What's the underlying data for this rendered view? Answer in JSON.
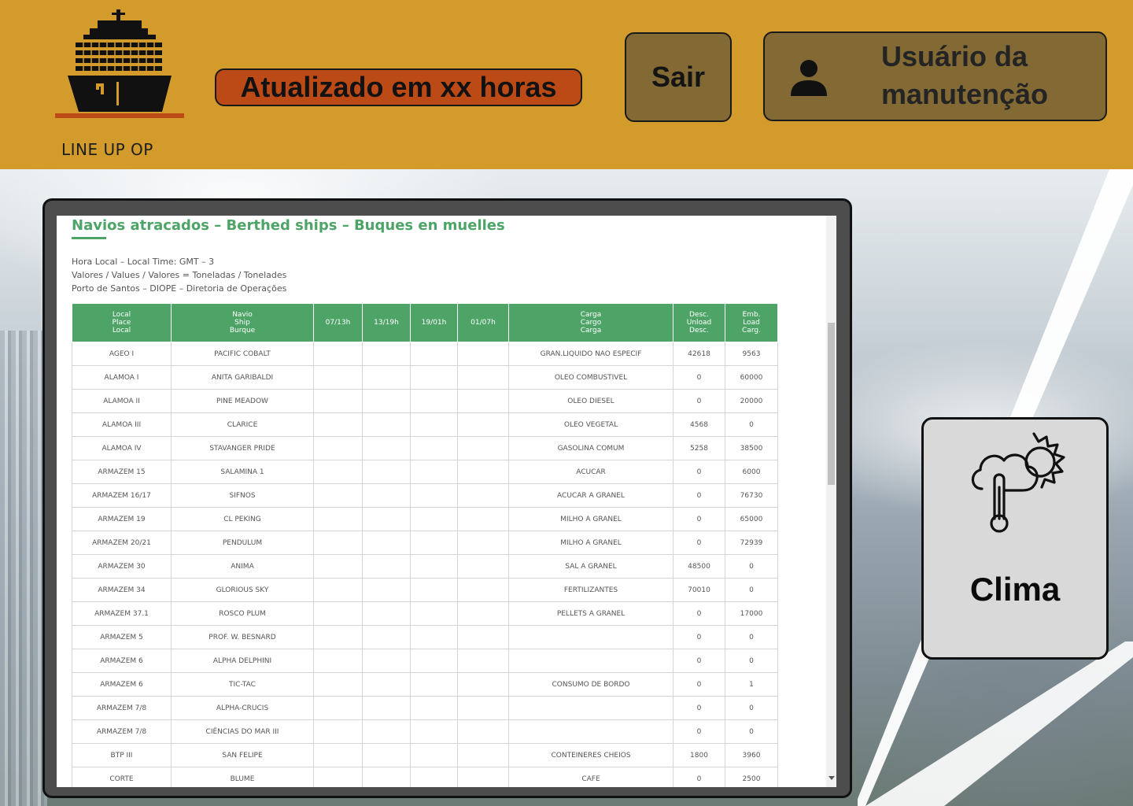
{
  "brand": {
    "name": "LINE UP OP"
  },
  "header": {
    "updated_label": "Atualizado em xx horas",
    "logout_label": "Sair",
    "user_label": "Usuário da manutenção"
  },
  "report": {
    "title": "Navios atracados – Berthed ships – Buques en muelles",
    "info": [
      "Hora Local – Local Time: GMT – 3",
      "Valores / Values / Valores = Toneladas / Tonelades",
      "Porto de Santos – DIOPE – Diretoria de Operações"
    ],
    "columns": [
      "Local\nPlace\nLocal",
      "Navio\nShip\nBurque",
      "07/13h",
      "13/19h",
      "19/01h",
      "01/07h",
      "Carga\nCargo\nCarga",
      "Desc.\nUnload\nDesc.",
      "Emb.\nLoad\nCarg."
    ],
    "rows": [
      [
        "AGEO I",
        "PACIFIC COBALT",
        "",
        "",
        "",
        "",
        "GRAN.LIQUIDO NAO ESPECIF",
        "42618",
        "9563"
      ],
      [
        "ALAMOA I",
        "ANITA GARIBALDI",
        "",
        "",
        "",
        "",
        "OLEO COMBUSTIVEL",
        "0",
        "60000"
      ],
      [
        "ALAMOA II",
        "PINE MEADOW",
        "",
        "",
        "",
        "",
        "OLEO DIESEL",
        "0",
        "20000"
      ],
      [
        "ALAMOA III",
        "CLARICE",
        "",
        "",
        "",
        "",
        "OLEO VEGETAL",
        "4568",
        "0"
      ],
      [
        "ALAMOA IV",
        "STAVANGER PRIDE",
        "",
        "",
        "",
        "",
        "GASOLINA COMUM",
        "5258",
        "38500"
      ],
      [
        "ARMAZEM 15",
        "SALAMINA 1",
        "",
        "",
        "",
        "",
        "ACUCAR",
        "0",
        "6000"
      ],
      [
        "ARMAZEM 16/17",
        "SIFNOS",
        "",
        "",
        "",
        "",
        "ACUCAR A GRANEL",
        "0",
        "76730"
      ],
      [
        "ARMAZEM 19",
        "CL PEKING",
        "",
        "",
        "",
        "",
        "MILHO A GRANEL",
        "0",
        "65000"
      ],
      [
        "ARMAZEM 20/21",
        "PENDULUM",
        "",
        "",
        "",
        "",
        "MILHO A GRANEL",
        "0",
        "72939"
      ],
      [
        "ARMAZEM 30",
        "ANIMA",
        "",
        "",
        "",
        "",
        "SAL A GRANEL",
        "48500",
        "0"
      ],
      [
        "ARMAZEM 34",
        "GLORIOUS SKY",
        "",
        "",
        "",
        "",
        "FERTILIZANTES",
        "70010",
        "0"
      ],
      [
        "ARMAZEM 37.1",
        "ROSCO PLUM",
        "",
        "",
        "",
        "",
        "PELLETS A GRANEL",
        "0",
        "17000"
      ],
      [
        "ARMAZEM 5",
        "PROF. W. BESNARD",
        "",
        "",
        "",
        "",
        "",
        "0",
        "0"
      ],
      [
        "ARMAZEM 6",
        "ALPHA DELPHINI",
        "",
        "",
        "",
        "",
        "",
        "0",
        "0"
      ],
      [
        "ARMAZEM 6",
        "TIC-TAC",
        "",
        "",
        "",
        "",
        "CONSUMO DE BORDO",
        "0",
        "1"
      ],
      [
        "ARMAZEM 7/8",
        "ALPHA-CRUCIS",
        "",
        "",
        "",
        "",
        "",
        "0",
        "0"
      ],
      [
        "ARMAZEM 7/8",
        "CIÊNCIAS DO MAR III",
        "",
        "",
        "",
        "",
        "",
        "0",
        "0"
      ],
      [
        "BTP III",
        "SAN FELIPE",
        "",
        "",
        "",
        "",
        "CONTEINERES CHEIOS",
        "1800",
        "3960"
      ],
      [
        "CORTE",
        "BLUME",
        "",
        "",
        "",
        "",
        "CAFE",
        "0",
        "2500"
      ]
    ]
  },
  "weather": {
    "label": "Clima",
    "icon": "weather-sun-cloud-thermometer-icon"
  },
  "colors": {
    "header_bg": "#d39b2c",
    "updated_bg": "#bb4a17",
    "button_bg": "#836a35",
    "table_header": "#4ea467",
    "clima_bg": "#d9d9d9"
  }
}
